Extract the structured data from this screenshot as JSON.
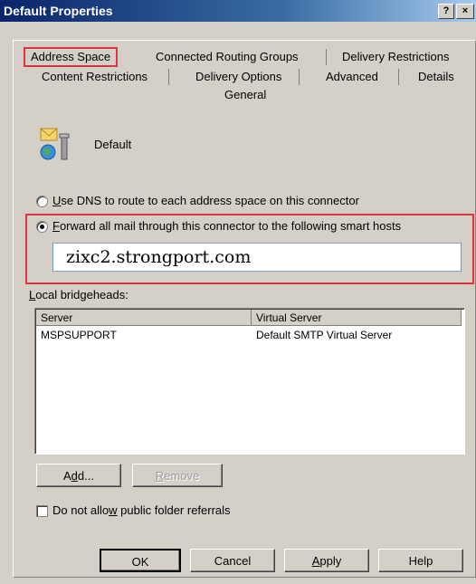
{
  "window": {
    "title": "Default Properties",
    "help_glyph": "?",
    "close_glyph": "×"
  },
  "tabs": {
    "row1": [
      "Address Space",
      "Connected Routing Groups",
      "Delivery Restrictions"
    ],
    "row2": [
      "Content Restrictions",
      "Delivery Options",
      "Advanced",
      "Details"
    ],
    "row3": [
      "General"
    ]
  },
  "connector": {
    "icon": "connector-globe-envelope-icon",
    "name": "Default"
  },
  "routing": {
    "dns_first": "U",
    "dns_rest": "se DNS to route to each address space on this connector",
    "forward_first": "F",
    "forward_rest": "orward all mail through this connector to the following smart hosts",
    "selected": "forward",
    "smart_hosts": "zixc2.strongport.com"
  },
  "bridgeheads": {
    "label_first": "L",
    "label_rest": "ocal bridgeheads:",
    "columns": [
      "Server",
      "Virtual Server"
    ],
    "rows": [
      [
        "MSPSUPPORT",
        "Default SMTP Virtual Server"
      ]
    ]
  },
  "actions": {
    "add_pre": "A",
    "add_u": "d",
    "add_post": "d...",
    "remove_pre": "",
    "remove_u": "R",
    "remove_post": "emove"
  },
  "referrals": {
    "pre": "Do not allo",
    "u": "w",
    "post": " public folder referrals",
    "checked": false
  },
  "footer": {
    "ok": "OK",
    "cancel": "Cancel",
    "apply_u": "A",
    "apply_rest": "pply",
    "help": "Help"
  },
  "colors": {
    "highlight_border": "#d9373b",
    "title_bar": "#0a246a",
    "dialog_bg": "#d4d0c8"
  }
}
